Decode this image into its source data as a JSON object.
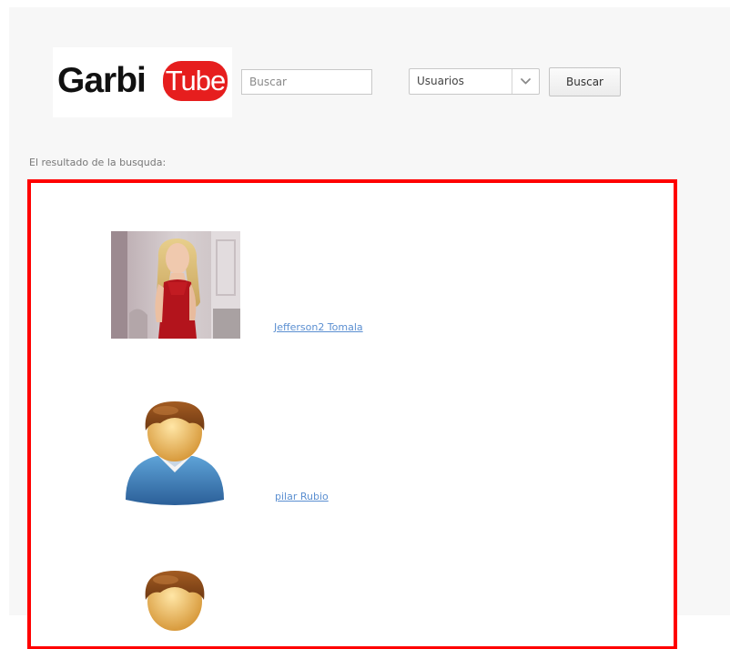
{
  "header": {
    "logo": {
      "part1": "Garbi",
      "part2": "Tube",
      "brand_colors": {
        "part1": "#111111",
        "part2_bg": "#e61e1e",
        "part2_text": "#ffffff"
      }
    },
    "search": {
      "placeholder": "Buscar",
      "value": ""
    },
    "filter": {
      "selected": "Usuarios",
      "icon": "chevron-down-icon"
    },
    "search_button_label": "Buscar"
  },
  "results": {
    "label": "El resultado de la busquda:",
    "highlight_color": "#ff0000",
    "items": [
      {
        "name": "Jefferson2 Tomala",
        "image": "user-photo"
      },
      {
        "name": "pilar Rubio",
        "image": "default-user-avatar-icon"
      },
      {
        "name": "",
        "image": "default-user-avatar-icon"
      }
    ]
  }
}
